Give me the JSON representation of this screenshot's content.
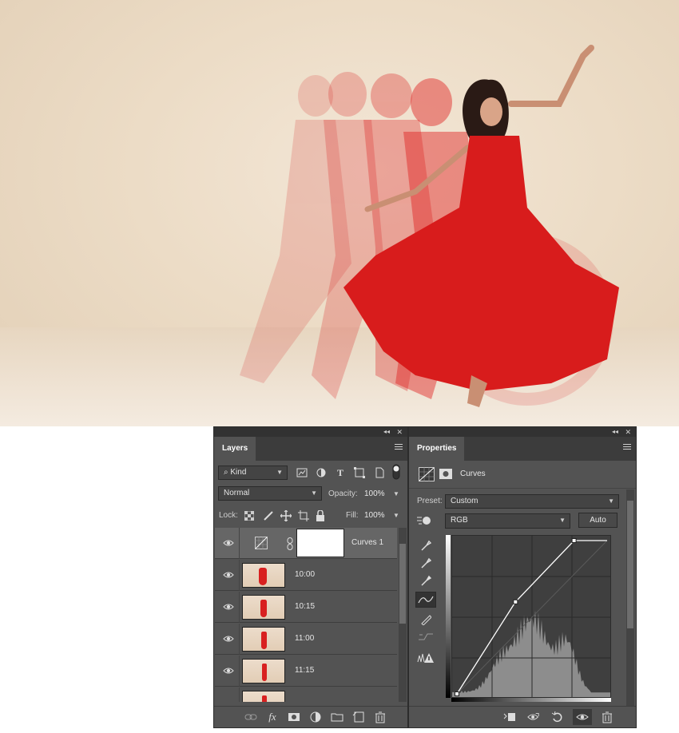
{
  "layers_panel": {
    "tab_label": "Layers",
    "filter": {
      "kind_label": "Kind"
    },
    "blend_mode": "Normal",
    "opacity": {
      "label": "Opacity:",
      "value": "100%"
    },
    "lock_label": "Lock:",
    "fill": {
      "label": "Fill:",
      "value": "100%"
    },
    "layers": [
      {
        "name": "Curves 1",
        "type": "adjustment",
        "selected": true
      },
      {
        "name": "10:00",
        "type": "image"
      },
      {
        "name": "10:15",
        "type": "image"
      },
      {
        "name": "11:00",
        "type": "image"
      },
      {
        "name": "11:15",
        "type": "image"
      }
    ],
    "footer_icons": [
      "link-icon",
      "fx-icon",
      "mask-icon",
      "adjustment-icon",
      "folder-icon",
      "new-layer-icon",
      "trash-icon"
    ]
  },
  "properties_panel": {
    "tab_label": "Properties",
    "header_title": "Curves",
    "preset": {
      "label": "Preset:",
      "value": "Custom"
    },
    "channel": "RGB",
    "auto_label": "Auto",
    "curve": {
      "points": [
        [
          0,
          0
        ],
        [
          0.39,
          0.6
        ],
        [
          0.78,
          1.0
        ]
      ]
    },
    "tools": [
      "target-hand-icon",
      "black-eyedropper-icon",
      "gray-eyedropper-icon",
      "white-eyedropper-icon",
      "curve-edit-icon",
      "pencil-icon",
      "smooth-icon",
      "clipping-warning-icon"
    ],
    "footer_icons": [
      "clip-to-layer-icon",
      "view-previous-icon",
      "reset-icon",
      "visibility-icon",
      "trash-icon"
    ]
  },
  "colors": {
    "panel_bg": "#535353",
    "panel_dark": "#323232",
    "selected_row": "#666666",
    "dress_red": "#d82020"
  }
}
